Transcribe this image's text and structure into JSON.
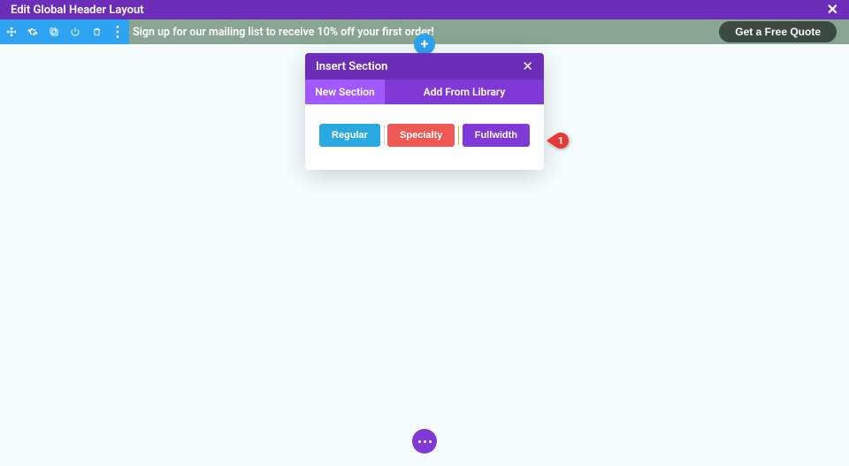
{
  "topbar": {
    "title": "Edit Global Header Layout"
  },
  "toolbar": {
    "icons": [
      "move",
      "settings",
      "duplicate",
      "power",
      "delete",
      "more"
    ]
  },
  "promo": {
    "text": "Sign up for our mailing list to receive  10% off your first order!",
    "cta_label": "Get a Free Quote"
  },
  "modal": {
    "title": "Insert Section",
    "tabs": {
      "new_section": "New Section",
      "add_from_library": "Add From Library"
    },
    "options": {
      "regular": "Regular",
      "specialty": "Specialty",
      "fullwidth": "Fullwidth"
    }
  },
  "annotation": {
    "step": "1"
  }
}
